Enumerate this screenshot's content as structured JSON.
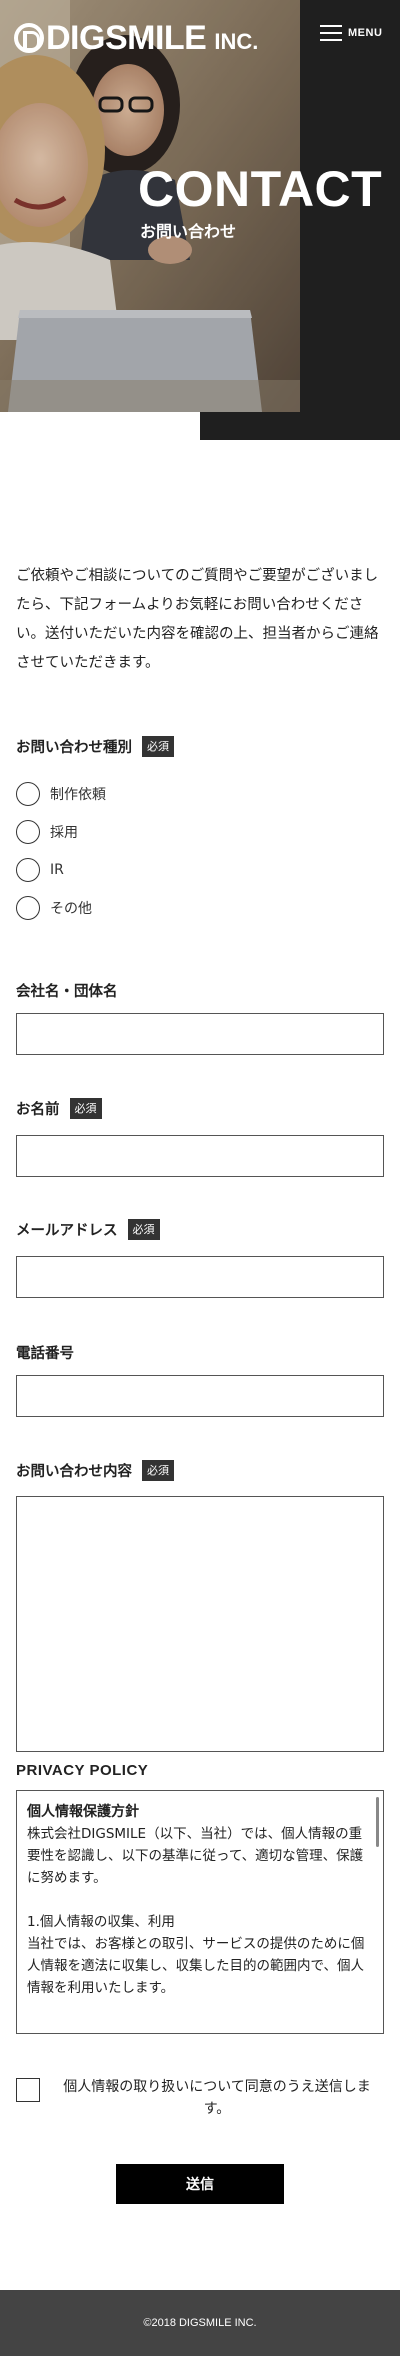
{
  "header": {
    "logo_text": "DIGSMILE",
    "logo_suffix": "INC.",
    "menu_label": "MENU"
  },
  "hero": {
    "title": "CONTACT",
    "subtitle": "お問い合わせ"
  },
  "intro": {
    "text": "ご依頼やご相談についてのご質問やご要望がございましたら、下記フォームよりお気軽にお問い合わせください。送付いただいた内容を確認の上、担当者からご連絡させていただきます。"
  },
  "form": {
    "required_badge": "必須",
    "inquiry_type": {
      "label": "お問い合わせ種別",
      "options": [
        "制作依頼",
        "採用",
        "IR",
        "その他"
      ]
    },
    "company": {
      "label": "会社名・団体名",
      "value": ""
    },
    "name": {
      "label": "お名前",
      "value": ""
    },
    "email": {
      "label": "メールアドレス",
      "value": ""
    },
    "phone": {
      "label": "電話番号",
      "value": ""
    },
    "message": {
      "label": "お問い合わせ内容",
      "value": ""
    }
  },
  "privacy": {
    "heading": "PRIVACY POLICY",
    "title": "個人情報保護方針",
    "para1": "株式会社DIGSMILE（以下、当社）では、個人情報の重要性を認識し、以下の基準に従って、適切な管理、保護に努めます。",
    "section1_title": "1.個人情報の収集、利用",
    "section1_text": "当社では、お客様との取引、サービスの提供のために個人情報を適法に収集し、収集した目的の範囲内で、個人情報を利用いたします。"
  },
  "agreement": {
    "text": "個人情報の取り扱いについて同意のうえ送信します。"
  },
  "submit_label": "送信",
  "footer": {
    "copyright": "©2018 DIGSMILE INC."
  }
}
